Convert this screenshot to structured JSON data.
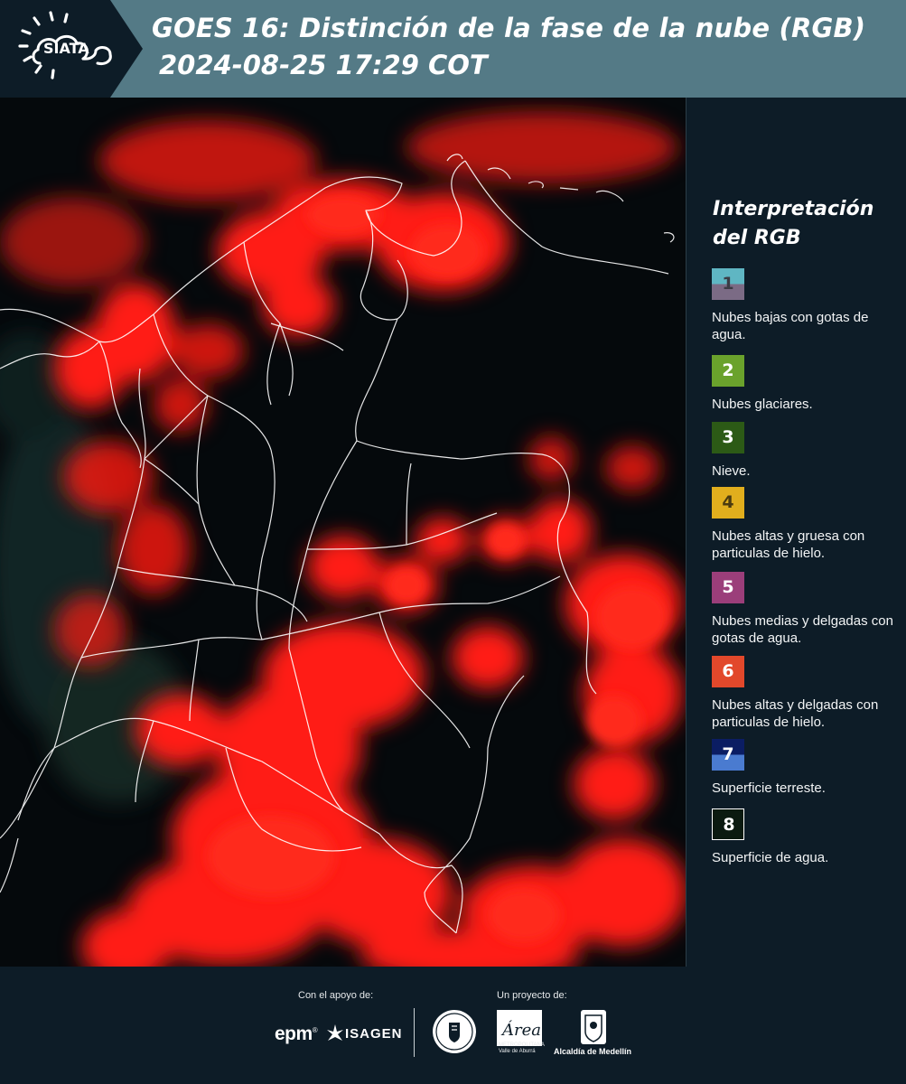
{
  "header": {
    "logo_text": "SIATA",
    "title_line1": "GOES 16: Distinción de la fase de la nube (RGB)",
    "title_line2": "2024-08-25 17:29 COT"
  },
  "map": {
    "background_color": "#05090c",
    "cloud_color": "#ff1c12",
    "border_color": "#ffffff",
    "icon": "satellite-rgb-composite"
  },
  "legend": {
    "title": "Interpretación del RGB",
    "items": [
      {
        "number": "1",
        "label": "Nubes bajas con gotas de agua.",
        "color_top": "#5fb6c3",
        "color_bottom": "#7b6b85",
        "text_color": "#3b3b44"
      },
      {
        "number": "2",
        "label": "Nubes glaciares.",
        "color_top": "#6aa22c",
        "color_bottom": "#6aa22c",
        "text_color": "#ffffff"
      },
      {
        "number": "3",
        "label": "Nieve.",
        "color_top": "#2c5a16",
        "color_bottom": "#2c5a16",
        "text_color": "#ffffff"
      },
      {
        "number": "4",
        "label": "Nubes altas y gruesa con particulas de hielo.",
        "color_top": "#e1ae1d",
        "color_bottom": "#e1ae1d",
        "text_color": "#4a3a10"
      },
      {
        "number": "5",
        "label": "Nubes medias y delgadas con gotas de agua.",
        "color_top": "#9b3e7a",
        "color_bottom": "#9b3e7a",
        "text_color": "#ffffff"
      },
      {
        "number": "6",
        "label": "Nubes altas y delgadas con particulas de hielo.",
        "color_top": "#e2482b",
        "color_bottom": "#e2482b",
        "text_color": "#ffffff"
      },
      {
        "number": "7",
        "label": "Superficie terreste.",
        "color_top": "#0b1d63",
        "color_bottom": "#4a7bd0",
        "text_color": "#ffffff"
      },
      {
        "number": "8",
        "label": "Superficie de agua.",
        "color_top": "#0b1a10",
        "color_bottom": "#0b1a10",
        "text_color": "#ffffff",
        "border": "#ffffff"
      }
    ]
  },
  "footer": {
    "support_label": "Con el apoyo de:",
    "project_label": "Un proyecto de:",
    "epm": "epm",
    "epm_mark": "®",
    "isagen": "ISAGEN",
    "area_name": "Área",
    "area_sub": "METROPOLITANA Valle de Aburrá",
    "alcaldia": "Alcaldía de Medellín"
  }
}
